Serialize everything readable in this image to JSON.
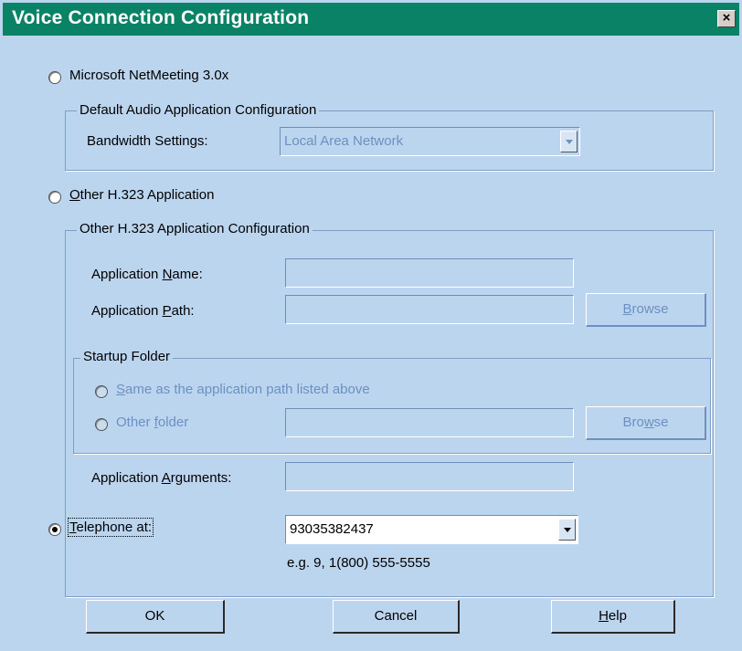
{
  "window": {
    "title": "Voice Connection Configuration",
    "close_label": "×"
  },
  "netmeeting": {
    "option_label": "Microsoft NetMeeting 3.0x",
    "group_title": "Default Audio Application Configuration",
    "bandwidth_label": "Bandwidth Settings:",
    "bandwidth_value": "Local Area Network"
  },
  "h323": {
    "option_label_key": "O",
    "option_label_rest": "ther H.323  Application",
    "group_title": "Other H.323 Application Configuration",
    "app_name_label_a": "Application ",
    "app_name_label_key": "N",
    "app_name_label_b": "ame:",
    "app_name_value": "",
    "app_path_label_a": "Application ",
    "app_path_label_key": "P",
    "app_path_label_b": "ath:",
    "app_path_value": "",
    "browse_label_key": "B",
    "browse_label_rest": "rowse",
    "startup": {
      "group_title": "Startup Folder",
      "same_key": "S",
      "same_rest": "ame as the application path listed above",
      "other_a": "O",
      "other_b": "ther ",
      "other_key": "f",
      "other_c": "older",
      "other_value": "",
      "browse2_a": "Bro",
      "browse2_key": "w",
      "browse2_b": "se"
    },
    "args_label_a": "Application ",
    "args_label_key": "A",
    "args_label_b": "rguments:",
    "args_value": ""
  },
  "telephone": {
    "option_label_key": "T",
    "option_label_rest": "elephone at:",
    "number_value": "93035382437",
    "example_text": "e.g. 9, 1(800) 555-5555"
  },
  "buttons": {
    "ok_label": "OK",
    "cancel_label": "Cancel",
    "help_key": "H",
    "help_rest": "elp"
  },
  "colors": {
    "title_bar": "#0a8266",
    "dialog_bg": "#bcd5ef",
    "disabled_text": "#6c90c2"
  }
}
